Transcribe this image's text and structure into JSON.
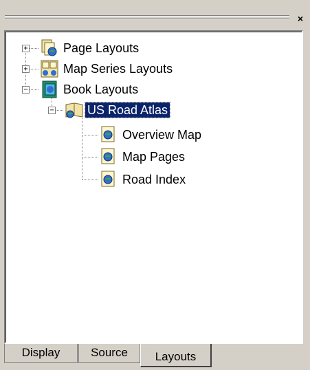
{
  "window": {
    "close_glyph": "×"
  },
  "tree": {
    "items": [
      {
        "label": "Page Layouts",
        "expander": "+",
        "icon": "page-layouts-icon"
      },
      {
        "label": "Map Series Layouts",
        "expander": "+",
        "icon": "map-series-icon"
      },
      {
        "label": "Book Layouts",
        "expander": "−",
        "icon": "book-icon"
      },
      {
        "label": "US Road Atlas",
        "expander": "−",
        "icon": "atlas-book-icon",
        "selected": true
      },
      {
        "label": "Overview Map",
        "icon": "map-page-icon"
      },
      {
        "label": "Map Pages",
        "icon": "map-page-icon"
      },
      {
        "label": "Road Index",
        "icon": "map-page-icon"
      }
    ]
  },
  "tabs": [
    {
      "label": "Display",
      "active": false
    },
    {
      "label": "Source",
      "active": false
    },
    {
      "label": "Layouts",
      "active": true
    }
  ],
  "colors": {
    "selection": "#0a246a",
    "face": "#d4d0c8"
  }
}
